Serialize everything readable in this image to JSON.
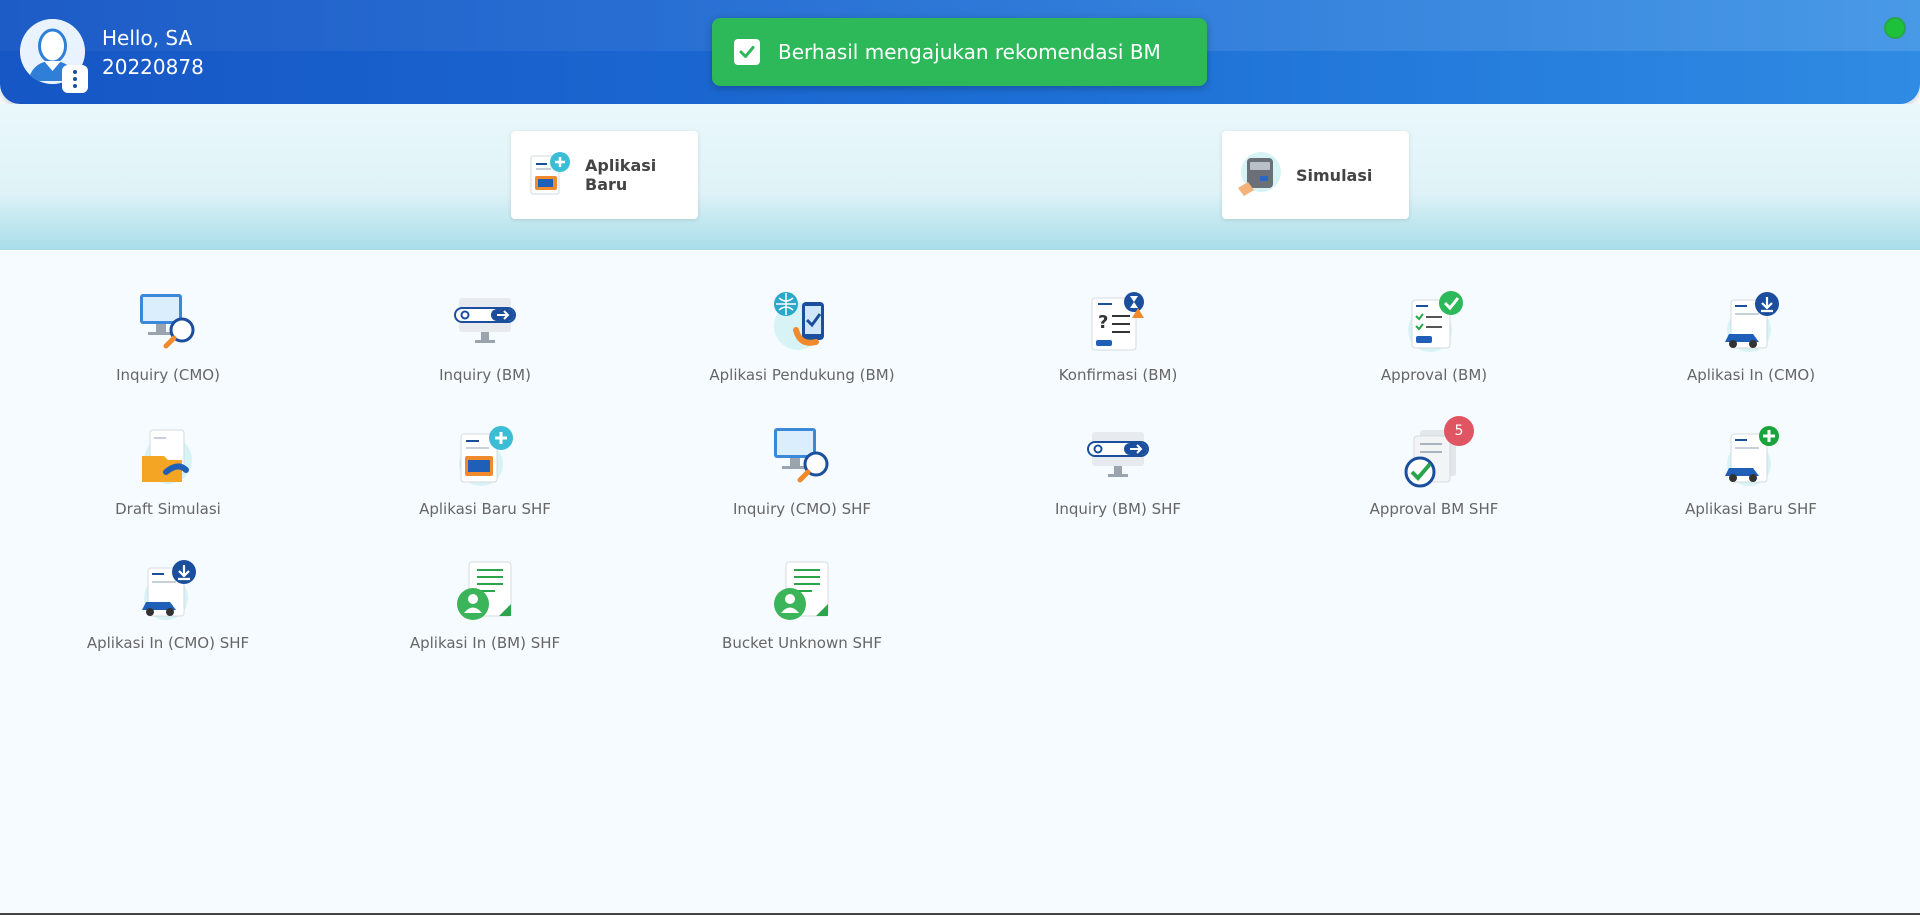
{
  "header": {
    "greeting": "Hello, SA",
    "user_id": "20220878",
    "status_color": "#1ec23a"
  },
  "toast": {
    "message": "Berhasil mengajukan rekomendasi BM",
    "color": "#2db85a"
  },
  "shortcuts": [
    {
      "label": "Aplikasi Baru",
      "icon": "new-application-icon"
    },
    {
      "label": "Simulasi",
      "icon": "calculator-icon"
    }
  ],
  "menu": [
    {
      "label": "Inquiry (CMO)",
      "icon": "monitor-search-icon"
    },
    {
      "label": "Inquiry (BM)",
      "icon": "monitor-searchbar-icon"
    },
    {
      "label": "Aplikasi Pendukung (BM)",
      "icon": "phone-globe-icon"
    },
    {
      "label": "Konfirmasi (BM)",
      "icon": "question-document-icon"
    },
    {
      "label": "Approval (BM)",
      "icon": "checklist-approve-icon"
    },
    {
      "label": "Aplikasi In (CMO)",
      "icon": "document-car-download-icon"
    },
    {
      "label": "Draft Simulasi",
      "icon": "draft-folder-icon"
    },
    {
      "label": "Aplikasi Baru SHF",
      "icon": "new-application-icon"
    },
    {
      "label": "Inquiry (CMO) SHF",
      "icon": "monitor-search-icon"
    },
    {
      "label": "Inquiry (BM) SHF",
      "icon": "monitor-searchbar-icon"
    },
    {
      "label": "Approval BM SHF",
      "icon": "document-check-icon",
      "badge": "5"
    },
    {
      "label": "Aplikasi Baru SHF",
      "icon": "document-car-add-icon"
    },
    {
      "label": "Aplikasi In (CMO) SHF",
      "icon": "document-car-download-icon"
    },
    {
      "label": "Aplikasi In (BM) SHF",
      "icon": "document-user-icon"
    },
    {
      "label": "Bucket Unknown SHF",
      "icon": "document-user-icon"
    }
  ]
}
